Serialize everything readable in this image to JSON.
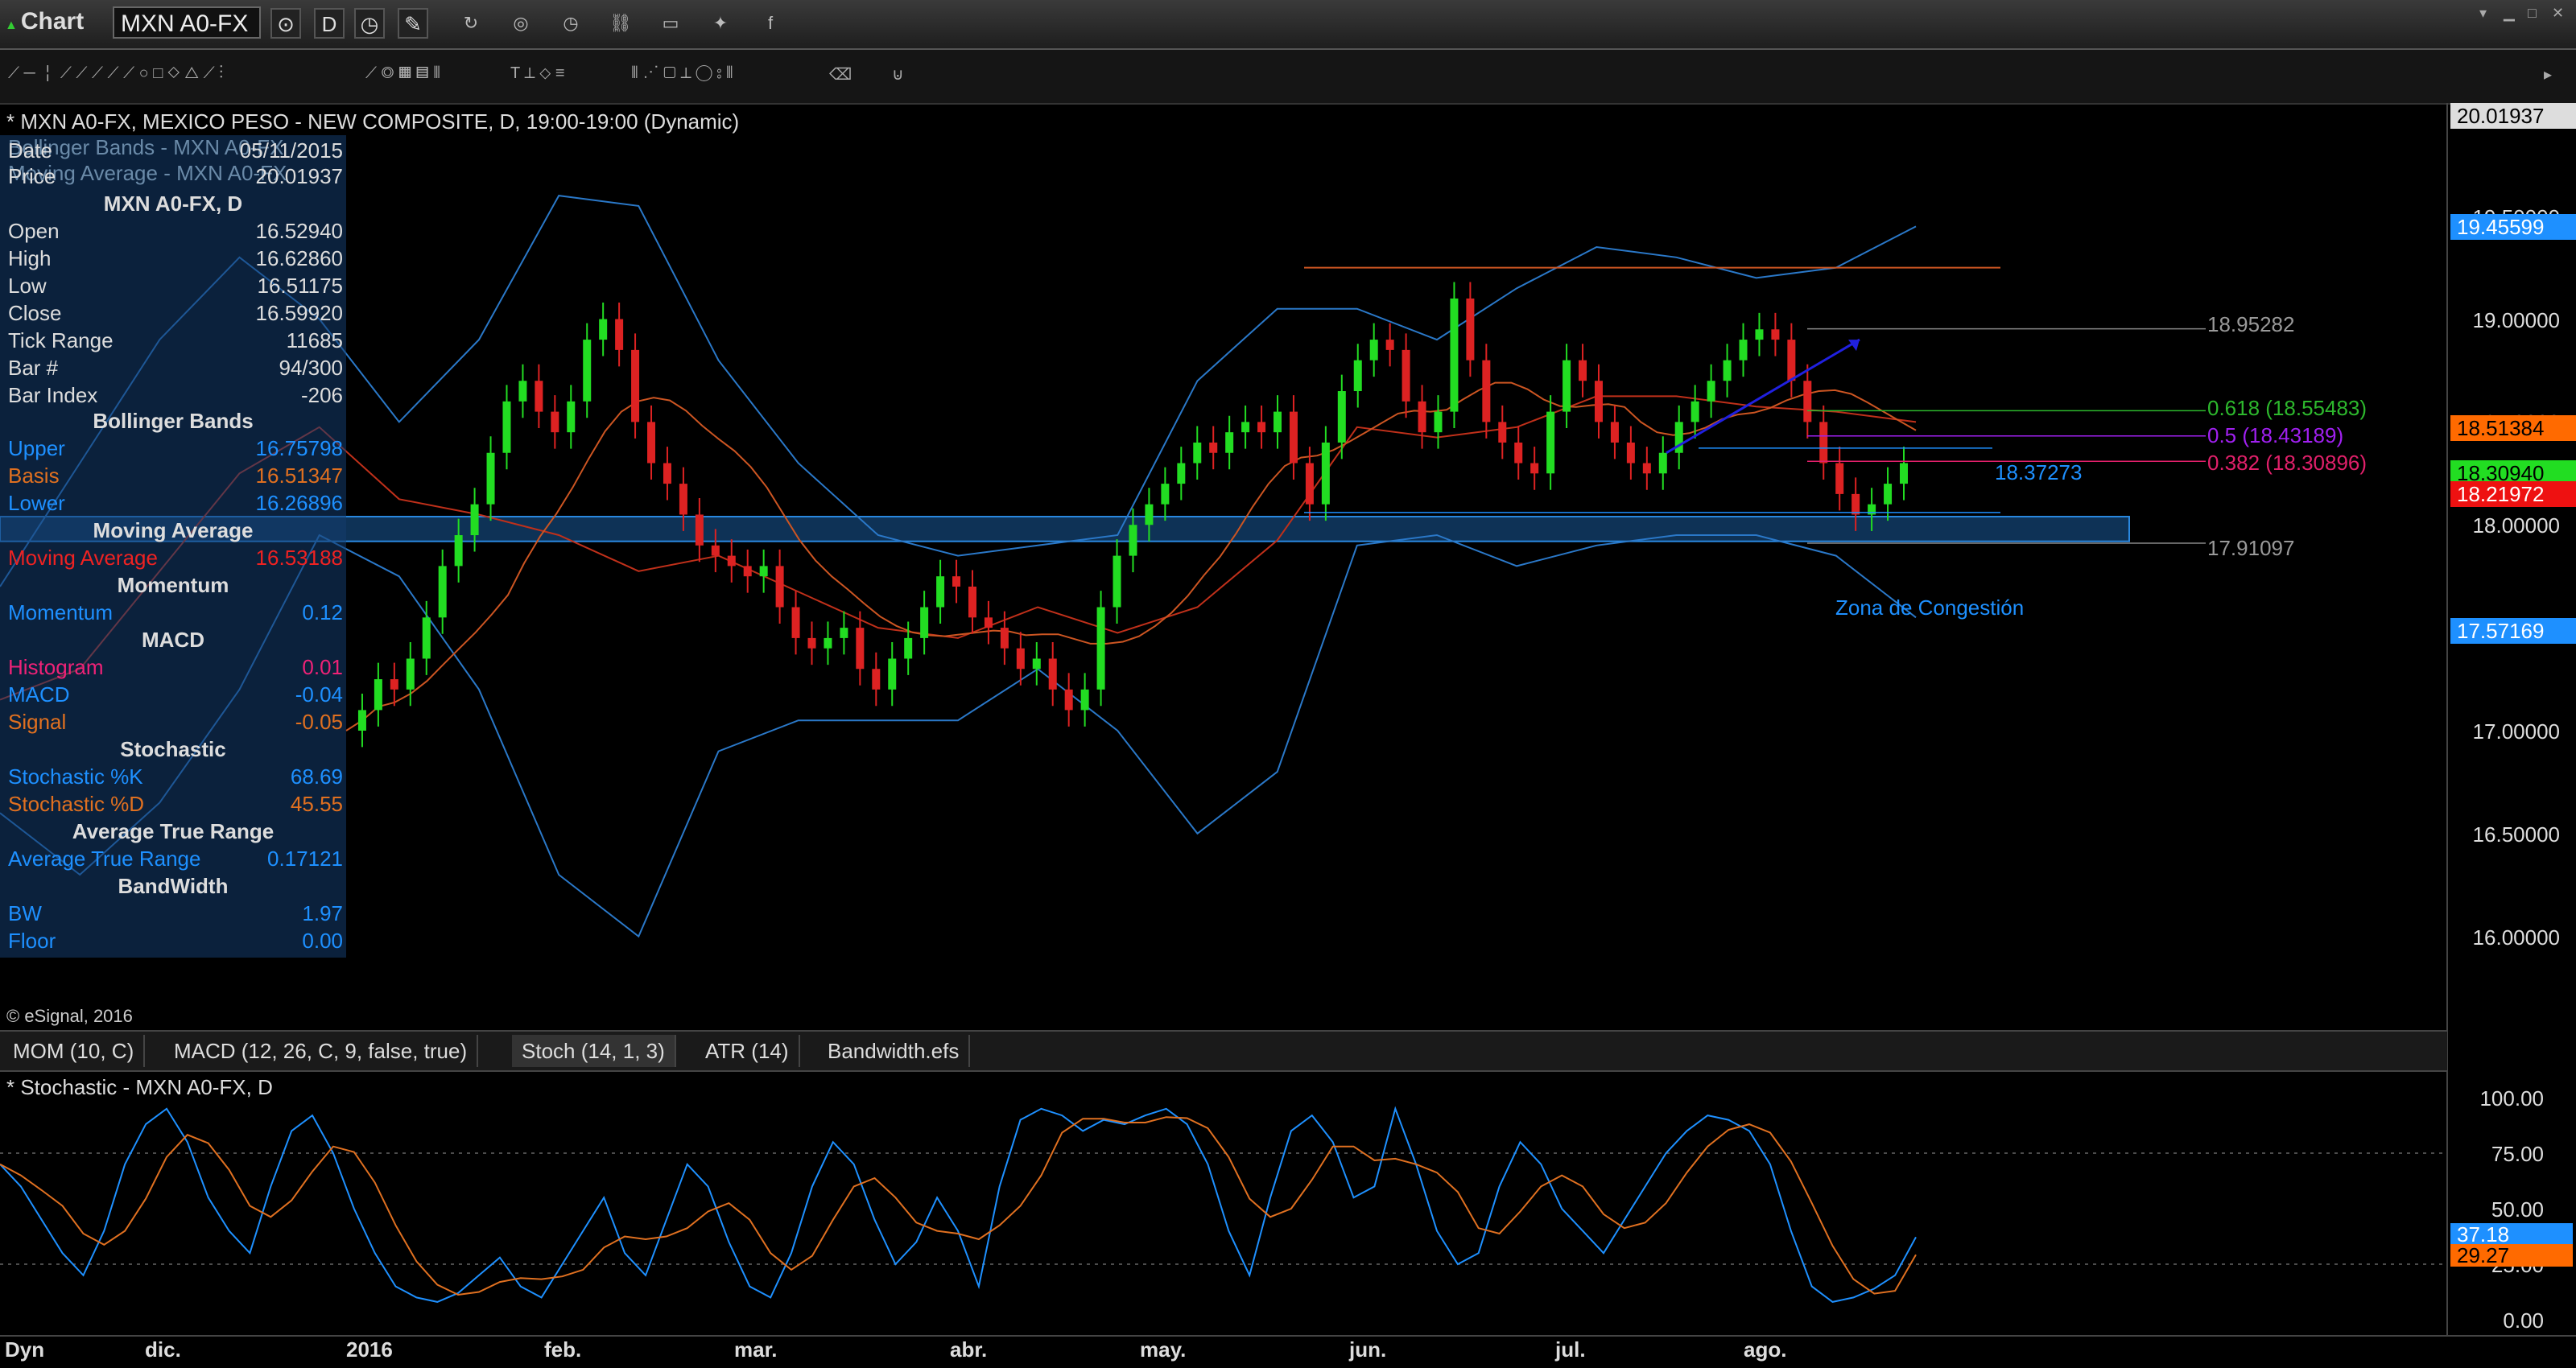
{
  "window": {
    "title": "Chart",
    "symbol": "MXN A0-FX",
    "interval": "D"
  },
  "chart_header": "* MXN A0-FX, MEXICO PESO - NEW COMPOSITE, D, 19:00-19:00 (Dynamic)",
  "data_window": {
    "ghost_lines": [
      "Bollinger Bands - MXN A0-FX",
      "Moving Average - MXN A0-FX"
    ],
    "date": {
      "label": "Date",
      "value": "05/11/2015"
    },
    "price": {
      "label": "Price",
      "value": "20.01937"
    },
    "symbol_heading": "MXN A0-FX, D",
    "ohlc": [
      {
        "label": "Open",
        "value": "16.52940"
      },
      {
        "label": "High",
        "value": "16.62860"
      },
      {
        "label": "Low",
        "value": "16.51175"
      },
      {
        "label": "Close",
        "value": "16.59920"
      },
      {
        "label": "Tick Range",
        "value": "11685"
      },
      {
        "label": "Bar #",
        "value": "94/300"
      },
      {
        "label": "Bar Index",
        "value": "-206"
      }
    ],
    "bollinger": {
      "heading": "Bollinger Bands",
      "upper_label": "Upper",
      "upper": "16.75798",
      "basis_label": "Basis",
      "basis": "16.51347",
      "lower_label": "Lower",
      "lower": "16.26896"
    },
    "ma": {
      "heading": "Moving Average",
      "label": "Moving Average",
      "value": "16.53188"
    },
    "momentum": {
      "heading": "Momentum",
      "label": "Momentum",
      "value": "0.12"
    },
    "macd": {
      "heading": "MACD",
      "hist_label": "Histogram",
      "hist": "0.01",
      "macd_label": "MACD",
      "macd": "-0.04",
      "signal_label": "Signal",
      "signal": "-0.05"
    },
    "stoch": {
      "heading": "Stochastic",
      "k_label": "Stochastic %K",
      "k": "68.69",
      "d_label": "Stochastic %D",
      "d": "45.55"
    },
    "atr": {
      "heading": "Average True Range",
      "label": "Average True Range",
      "value": "0.17121"
    },
    "bw": {
      "heading": "BandWidth",
      "bw_label": "BW",
      "bw": "1.97",
      "floor_label": "Floor",
      "floor": "0.00"
    }
  },
  "price_axis": {
    "ticks": [
      "19.50000",
      "19.00000",
      "18.50000",
      "18.00000",
      "17.50000",
      "17.00000",
      "16.50000",
      "16.00000"
    ],
    "labels": {
      "top": "20.01937",
      "upper_band": "19.45599",
      "ma": "18.51384",
      "close": "18.30940",
      "basis": "18.21972",
      "lower_band": "17.57169"
    }
  },
  "annotations": {
    "fib_high": "18.95282",
    "fib_618": "0.618 (18.55483)",
    "fib_50": "0.5 (18.43189)",
    "fib_382": "0.382 (18.30896)",
    "fib_low": "17.91097",
    "level": "18.37273",
    "zone": "Zona de Congestión"
  },
  "copyright": "© eSignal, 2016",
  "tabs": [
    "MOM (10, C)",
    "MACD (12, 26, C, 9, false, true)",
    "Stoch (14, 1, 3)",
    "ATR (14)",
    "Bandwidth.efs"
  ],
  "active_tab": 2,
  "indicator_title": "* Stochastic - MXN A0-FX, D",
  "stoch_axis": {
    "ticks": [
      "100.00",
      "75.00",
      "50.00",
      "25.00",
      "0.00"
    ],
    "k_label": "37.18",
    "d_label": "29.27"
  },
  "x_axis": {
    "corner": "Dyn",
    "labels": [
      "dic.",
      "2016",
      "feb.",
      "mar.",
      "abr.",
      "may.",
      "jun.",
      "jul.",
      "ago."
    ]
  },
  "colors": {
    "up": "#22dd22",
    "down": "#dd2222",
    "band": "#2a78c8",
    "ma": "#cc5522",
    "accent": "#1e90ff"
  },
  "chart_data": {
    "type": "candlestick",
    "title": "* MXN A0-FX, MEXICO PESO - NEW COMPOSITE, D, 19:00-19:00 (Dynamic)",
    "ylim": [
      15.6,
      20.05
    ],
    "x_ticks": [
      "dic.",
      "2016",
      "feb.",
      "mar.",
      "abr.",
      "may.",
      "jun.",
      "jul.",
      "ago."
    ],
    "close_path": [
      17.0,
      17.1,
      17.25,
      17.2,
      17.35,
      17.55,
      17.8,
      17.95,
      18.1,
      18.35,
      18.6,
      18.7,
      18.55,
      18.45,
      18.6,
      18.9,
      19.0,
      18.85,
      18.5,
      18.3,
      18.2,
      18.05,
      17.9,
      17.85,
      17.8,
      17.75,
      17.8,
      17.6,
      17.45,
      17.4,
      17.45,
      17.5,
      17.3,
      17.2,
      17.35,
      17.45,
      17.6,
      17.75,
      17.7,
      17.55,
      17.5,
      17.4,
      17.3,
      17.35,
      17.2,
      17.1,
      17.2,
      17.6,
      17.85,
      18.0,
      18.1,
      18.2,
      18.3,
      18.4,
      18.35,
      18.45,
      18.5,
      18.45,
      18.55,
      18.3,
      18.1,
      18.4,
      18.65,
      18.8,
      18.9,
      18.85,
      18.6,
      18.45,
      18.55,
      19.1,
      18.8,
      18.5,
      18.4,
      18.3,
      18.25,
      18.55,
      18.8,
      18.7,
      18.5,
      18.4,
      18.3,
      18.25,
      18.35,
      18.5,
      18.6,
      18.7,
      18.8,
      18.9,
      18.95,
      18.9,
      18.7,
      18.5,
      18.3,
      18.15,
      18.05,
      18.1,
      18.2,
      18.3
    ],
    "bands": {
      "upper_path": [
        17.7,
        18.3,
        18.9,
        19.3,
        19.0,
        18.5,
        18.9,
        19.6,
        19.55,
        18.8,
        18.3,
        17.95,
        17.85,
        17.9,
        17.95,
        18.7,
        19.05,
        19.05,
        18.9,
        19.15,
        19.35,
        19.3,
        19.2,
        19.25,
        19.45
      ],
      "lower_path": [
        16.6,
        16.3,
        16.65,
        17.2,
        17.95,
        17.75,
        17.2,
        16.3,
        16.0,
        16.9,
        17.05,
        17.05,
        17.05,
        17.3,
        17.0,
        16.5,
        16.8,
        17.9,
        17.95,
        17.8,
        17.9,
        17.95,
        17.95,
        17.85,
        17.55
      ]
    },
    "stochastic": {
      "ylim": [
        0,
        100
      ],
      "k_last": 37.18,
      "d_last": 29.27
    }
  }
}
